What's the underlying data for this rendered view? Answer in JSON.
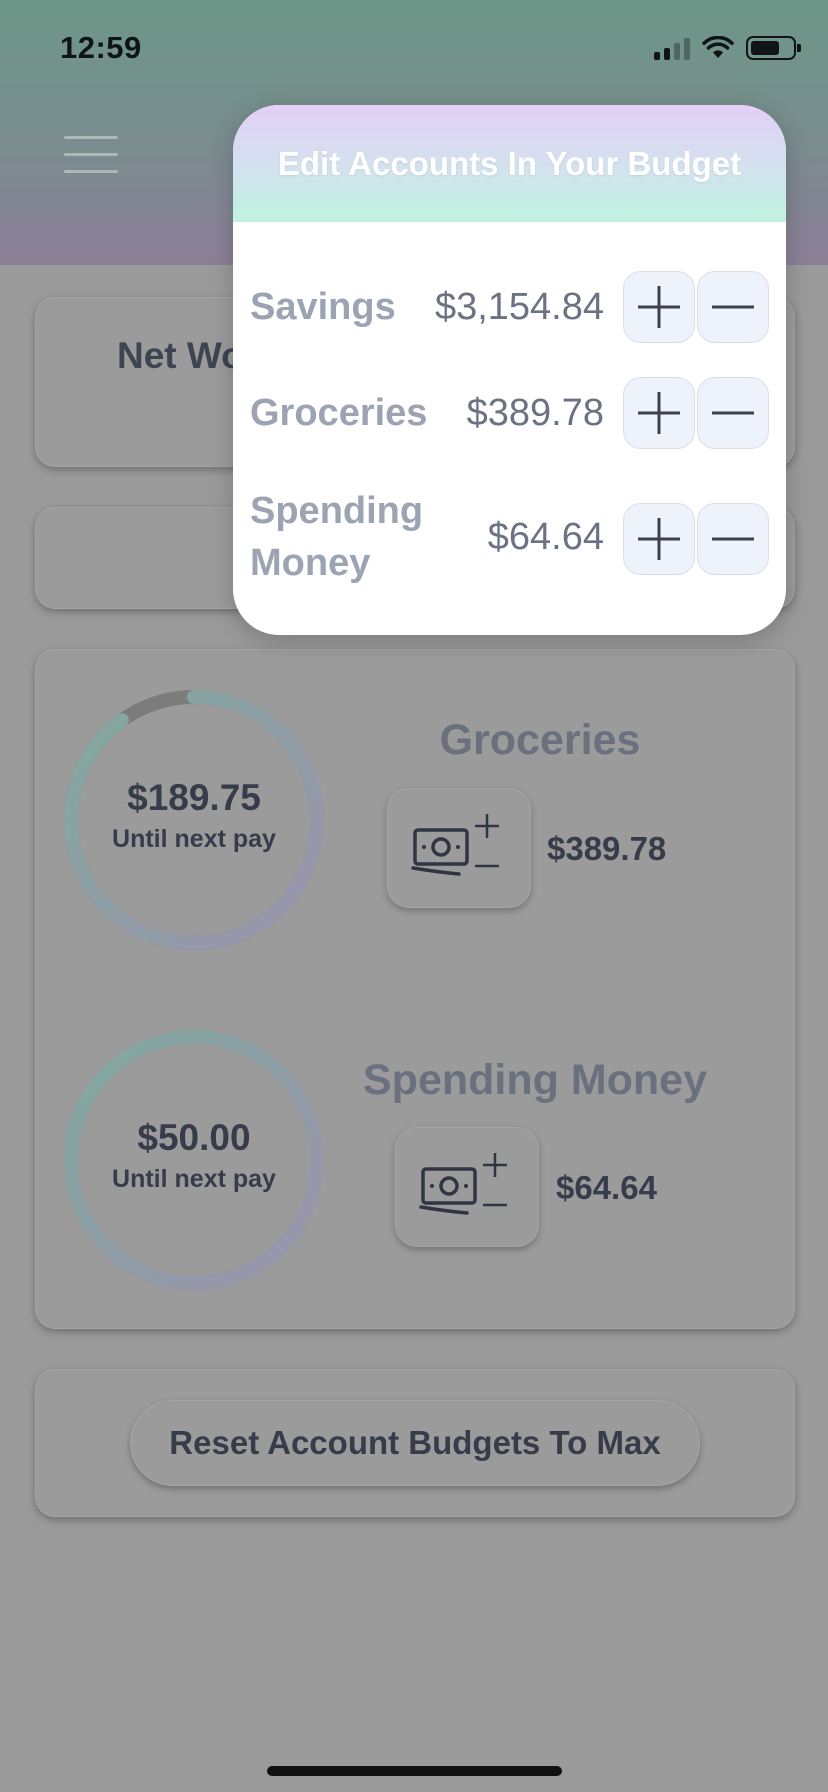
{
  "status_bar": {
    "time": "12:59"
  },
  "background": {
    "net_worth_label": "Net Wo",
    "accounts": [
      {
        "name": "Groceries",
        "ring_amount": "$189.75",
        "ring_sub": "Until next pay",
        "balance": "$389.78",
        "progress": 0.9
      },
      {
        "name": "Spending Money",
        "ring_amount": "$50.00",
        "ring_sub": "Until next pay",
        "balance": "$64.64",
        "progress": 1.0
      }
    ],
    "reset_label": "Reset Account Budgets To Max"
  },
  "modal": {
    "title": "Edit Accounts In Your Budget",
    "rows": [
      {
        "name": "Savings",
        "value": "$3,154.84"
      },
      {
        "name": "Groceries",
        "value": "$389.78"
      },
      {
        "name": "Spending Money",
        "value": "$64.64"
      }
    ]
  },
  "colors": {
    "header_top": "#6c9787",
    "header_bottom": "#8c7f98",
    "overlay_gray": "#9a9a9a",
    "ring_teal": "#7fa69c",
    "ring_purple": "#9d92ad",
    "modal_title_text": "#ffffff",
    "modal_row_label": "#9ca3b2"
  },
  "icons": [
    "menu-icon",
    "cellular-signal-icon",
    "wifi-icon",
    "battery-icon",
    "cash-plus-minus-icon",
    "plus-icon",
    "minus-icon"
  ]
}
